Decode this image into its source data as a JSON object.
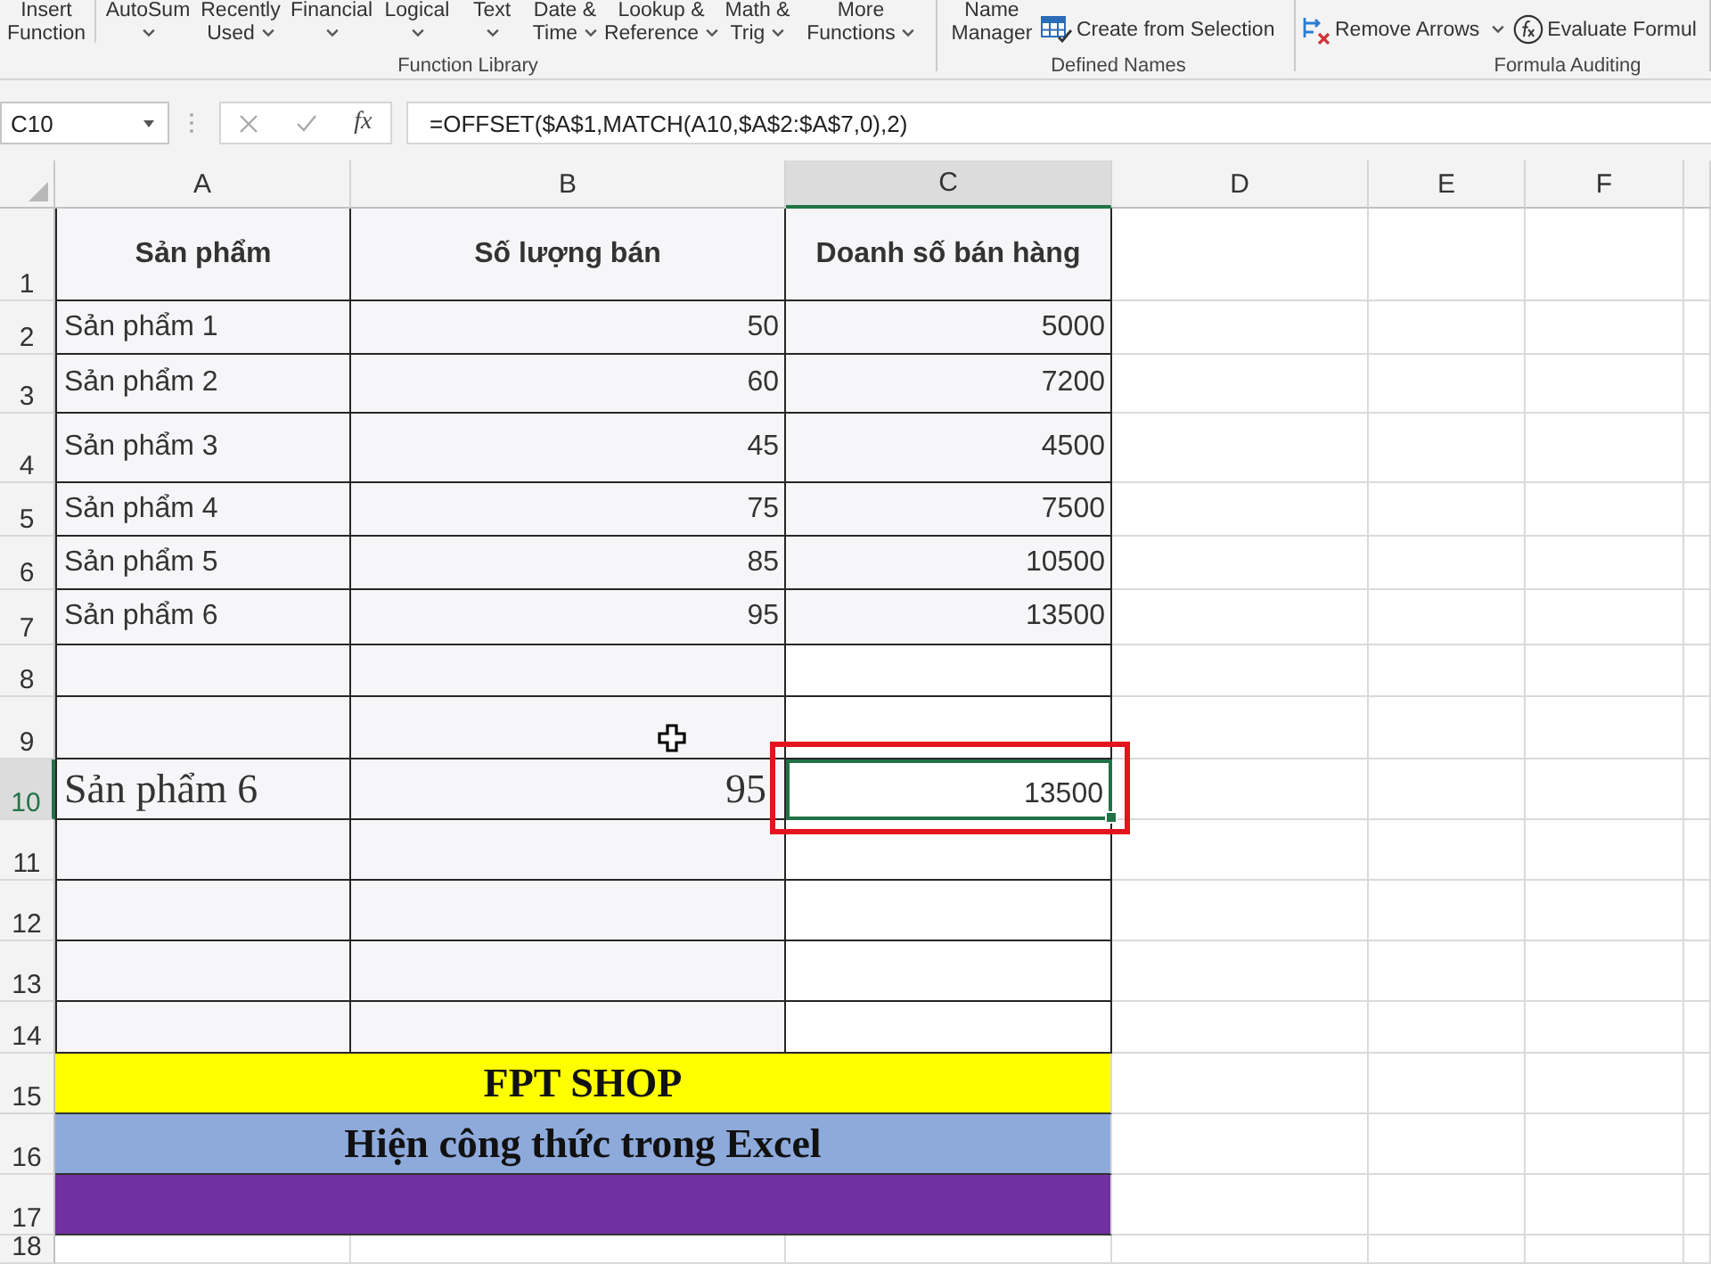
{
  "ribbon": {
    "groups": [
      {
        "label": "Function Library",
        "large_buttons": [
          {
            "lines": [
              "Insert",
              "Function"
            ],
            "dropdown": false
          },
          {
            "lines": [
              "AutoSum"
            ],
            "dropdown": true
          },
          {
            "lines": [
              "Recently",
              "Used"
            ],
            "dropdown": true
          },
          {
            "lines": [
              "Financial"
            ],
            "dropdown": true
          },
          {
            "lines": [
              "Logical"
            ],
            "dropdown": true
          },
          {
            "lines": [
              "Text"
            ],
            "dropdown": true
          },
          {
            "lines": [
              "Date &",
              "Time"
            ],
            "dropdown": true
          },
          {
            "lines": [
              "Lookup &",
              "Reference"
            ],
            "dropdown": true
          },
          {
            "lines": [
              "Math &",
              "Trig"
            ],
            "dropdown": true
          },
          {
            "lines": [
              "More",
              "Functions"
            ],
            "dropdown": true
          }
        ]
      },
      {
        "label": "Defined Names",
        "large_buttons": [
          {
            "lines": [
              "Name",
              "Manager"
            ],
            "dropdown": false
          }
        ],
        "small_buttons": [
          {
            "label": "Create from Selection",
            "dropdown": false
          }
        ]
      },
      {
        "label": "Formula Auditing",
        "small_buttons": [
          {
            "label": "Remove Arrows",
            "dropdown": true
          },
          {
            "label": "Evaluate Formul",
            "dropdown": false
          }
        ]
      }
    ]
  },
  "formula_bar": {
    "name_box": "C10",
    "function_label": "fx",
    "formula": "=OFFSET($A$1,MATCH(A10,$A$2:$A$7,0),2)"
  },
  "sheet": {
    "columns": [
      {
        "label": "A",
        "selected": false
      },
      {
        "label": "B",
        "selected": false
      },
      {
        "label": "C",
        "selected": true
      },
      {
        "label": "D",
        "selected": false
      },
      {
        "label": "E",
        "selected": false
      },
      {
        "label": "F",
        "selected": false
      }
    ],
    "rows": [
      {
        "label": "1",
        "selected": false,
        "kind": "header",
        "cells": [
          "Sản phẩm",
          "Số lượng bán",
          "Doanh số bán hàng"
        ]
      },
      {
        "label": "2",
        "selected": false,
        "kind": "data",
        "cells": [
          "Sản phẩm 1",
          "50",
          "5000"
        ]
      },
      {
        "label": "3",
        "selected": false,
        "kind": "data",
        "cells": [
          "Sản phẩm 2",
          "60",
          "7200"
        ]
      },
      {
        "label": "4",
        "selected": false,
        "kind": "data",
        "cells": [
          "Sản phẩm 3",
          "45",
          "4500"
        ]
      },
      {
        "label": "5",
        "selected": false,
        "kind": "data",
        "cells": [
          "Sản phẩm 4",
          "75",
          "7500"
        ]
      },
      {
        "label": "6",
        "selected": false,
        "kind": "data",
        "cells": [
          "Sản phẩm 5",
          "85",
          "10500"
        ]
      },
      {
        "label": "7",
        "selected": false,
        "kind": "data",
        "cells": [
          "Sản phẩm 6",
          "95",
          "13500"
        ]
      },
      {
        "label": "8",
        "selected": false,
        "kind": "blank"
      },
      {
        "label": "9",
        "selected": false,
        "kind": "blank"
      },
      {
        "label": "10",
        "selected": true,
        "kind": "lookup",
        "cells": [
          "Sản phẩm 6",
          "95",
          "13500"
        ],
        "highlighted": true
      },
      {
        "label": "11",
        "selected": false,
        "kind": "blank"
      },
      {
        "label": "12",
        "selected": false,
        "kind": "blank"
      },
      {
        "label": "13",
        "selected": false,
        "kind": "blank"
      },
      {
        "label": "14",
        "selected": false,
        "kind": "blank"
      },
      {
        "label": "15",
        "selected": false,
        "kind": "banner",
        "text": "FPT SHOP",
        "color": "#ffff00"
      },
      {
        "label": "16",
        "selected": false,
        "kind": "banner",
        "text": "Hiện công thức trong Excel",
        "color": "#8eaadb"
      },
      {
        "label": "17",
        "selected": false,
        "kind": "banner",
        "color": "#7030a0"
      },
      {
        "label": "18",
        "selected": false,
        "kind": "empty"
      }
    ]
  }
}
